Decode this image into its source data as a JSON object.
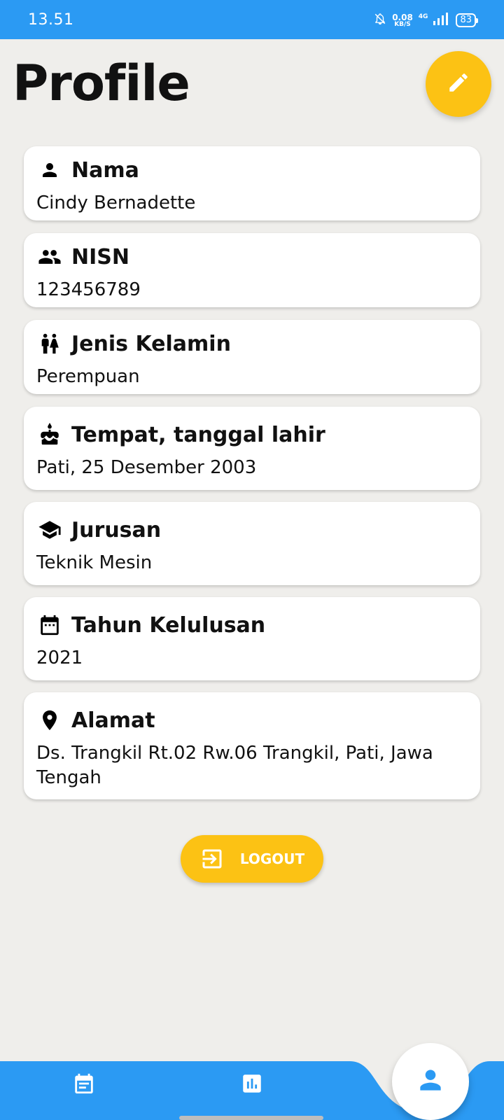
{
  "status_bar": {
    "time": "13.51",
    "net_speed_value": "0.08",
    "net_speed_unit": "KB/S",
    "network_type": "4G",
    "battery": "83"
  },
  "header": {
    "title": "Profile"
  },
  "fields": [
    {
      "label": "Nama",
      "value": "Cindy Bernadette",
      "icon": "person-icon"
    },
    {
      "label": "NISN",
      "value": "123456789",
      "icon": "people-icon"
    },
    {
      "label": "Jenis Kelamin",
      "value": "Perempuan",
      "icon": "wc-icon"
    },
    {
      "label": "Tempat, tanggal lahir",
      "value": "Pati, 25 Desember 2003",
      "icon": "cake-icon"
    },
    {
      "label": "Jurusan",
      "value": "Teknik Mesin",
      "icon": "school-icon"
    },
    {
      "label": "Tahun Kelulusan",
      "value": "2021",
      "icon": "calendar-icon"
    },
    {
      "label": "Alamat",
      "value": "Ds. Trangkil Rt.02 Rw.06 Trangkil, Pati, Jawa Tengah",
      "icon": "location-pin-icon"
    }
  ],
  "logout": {
    "label": "LOGOUT"
  },
  "colors": {
    "primary": "#2b9af3",
    "accent": "#fcc214",
    "background": "#efeeeb"
  },
  "bottom_nav": {
    "items": [
      "schedule-icon",
      "chart-icon",
      "profile-icon"
    ],
    "active": "profile-icon"
  }
}
